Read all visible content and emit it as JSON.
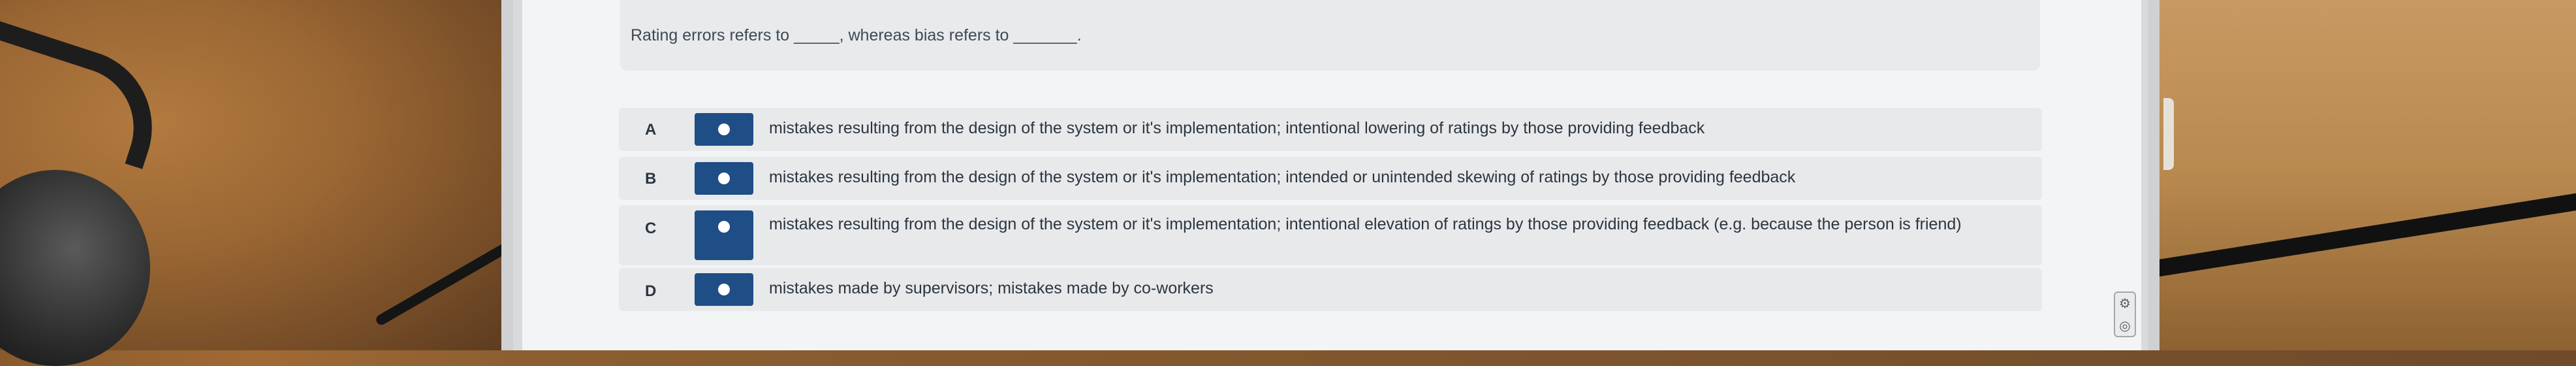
{
  "question": {
    "text": "Rating errors refers to _____, whereas bias refers to _______."
  },
  "options": [
    {
      "letter": "A",
      "text": "mistakes resulting from the design of the system or it's implementation; intentional lowering of ratings by those providing feedback"
    },
    {
      "letter": "B",
      "text": "mistakes resulting from the design of the system or it's implementation; intended or unintended skewing of ratings by those providing feedback"
    },
    {
      "letter": "C",
      "text": "mistakes resulting from the design of the system or it's implementation; intentional elevation of ratings by those providing feedback (e.g. because the person is friend)"
    },
    {
      "letter": "D",
      "text": "mistakes made by supervisors; mistakes made by co-workers"
    }
  ],
  "colors": {
    "accent": "#1f4d86",
    "option_bg": "#e7e9eb",
    "text": "#2c3640"
  },
  "widget": {
    "icons": [
      "settings-icon",
      "accessibility-icon"
    ]
  }
}
